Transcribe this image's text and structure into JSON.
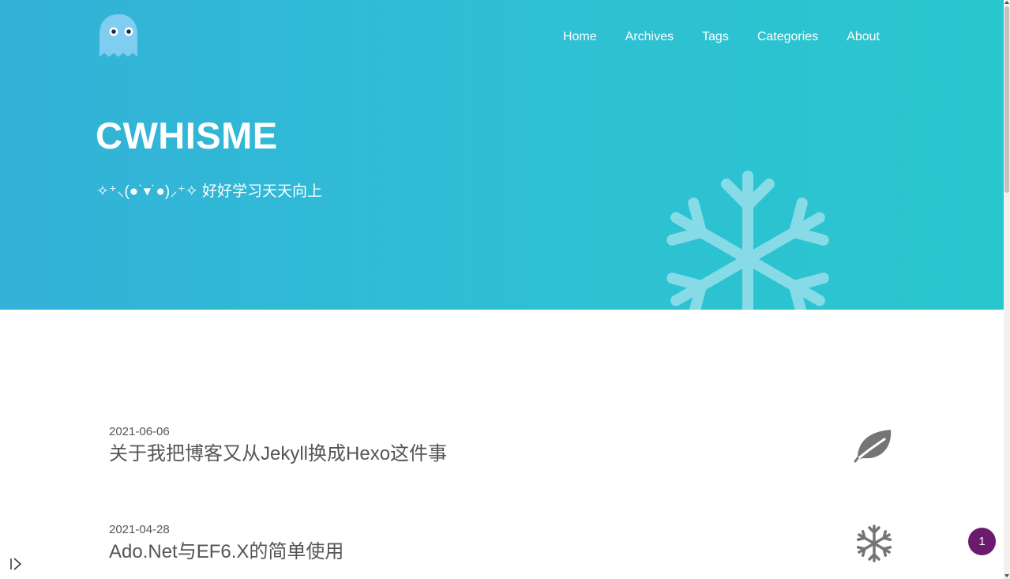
{
  "nav": {
    "items": [
      {
        "label": "Home"
      },
      {
        "label": "Archives"
      },
      {
        "label": "Tags"
      },
      {
        "label": "Categories"
      },
      {
        "label": "About"
      }
    ]
  },
  "hero": {
    "title": "CWHISME",
    "subtitle": "✧⁺⸜(●˙▾˙●)⸝⁺✧ 好好学习天天向上",
    "background_color": "#2ec0d4"
  },
  "posts": [
    {
      "date": "2021-06-06",
      "title": "关于我把博客又从Jekyll换成Hexo这件事",
      "icon": "leaf-icon"
    },
    {
      "date": "2021-04-28",
      "title": "Ado.Net与EF6.X的简单使用",
      "icon": "snowflake-icon"
    }
  ],
  "badge": {
    "count": "1",
    "color": "#6a1b6e"
  }
}
